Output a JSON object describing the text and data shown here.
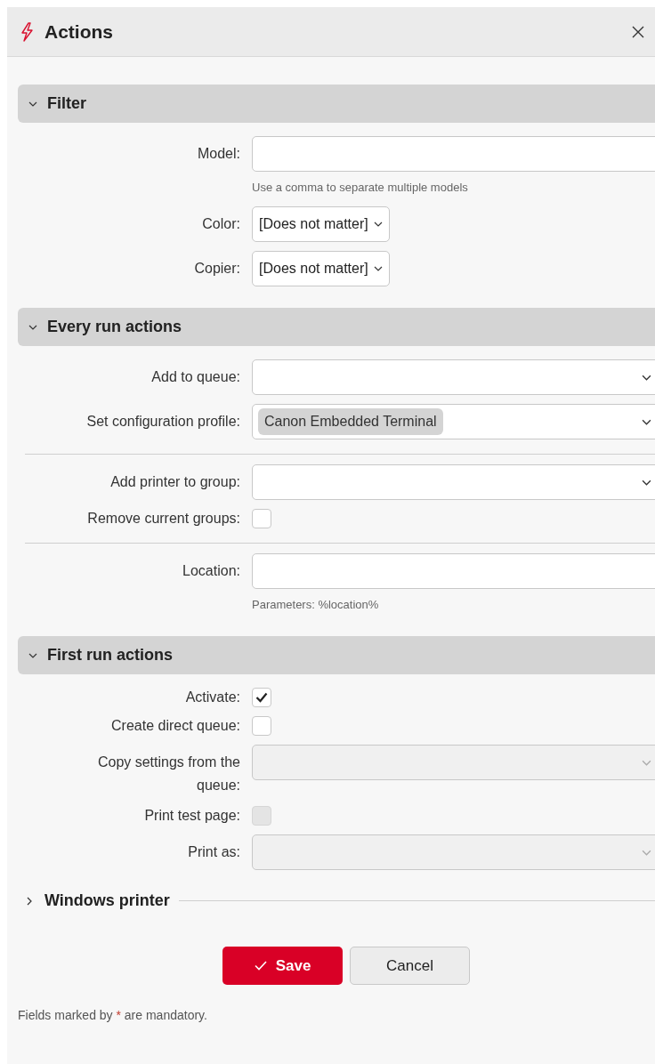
{
  "dialog": {
    "title": "Actions"
  },
  "sections": [
    {
      "title": "Filter",
      "expanded": true,
      "rows": [
        {
          "kind": "text",
          "label": "Model:",
          "hint": "Use a comma to separate multiple models"
        },
        {
          "kind": "select",
          "label": "Color:",
          "value": "[Does not matter]"
        },
        {
          "kind": "select",
          "label": "Copier:",
          "value": "[Does not matter]"
        }
      ]
    },
    {
      "title": "Every run actions",
      "expanded": true,
      "rows": [
        {
          "kind": "combo",
          "label": "Add to queue:",
          "disabled": false
        },
        {
          "kind": "combo",
          "label": "Set configuration profile:",
          "disabled": false,
          "tags": [
            "Canon Embedded Terminal"
          ]
        },
        {
          "kind": "divider"
        },
        {
          "kind": "combo",
          "label": "Add printer to group:",
          "disabled": false
        },
        {
          "kind": "checkbox",
          "label": "Remove current groups:",
          "checked": false,
          "disabled": false
        },
        {
          "kind": "divider"
        },
        {
          "kind": "text",
          "label": "Location:",
          "hint": "Parameters: %location%"
        }
      ]
    },
    {
      "title": "First run actions",
      "expanded": true,
      "rows": [
        {
          "kind": "checkbox",
          "label": "Activate:",
          "checked": true,
          "disabled": false
        },
        {
          "kind": "checkbox",
          "label": "Create direct queue:",
          "checked": false,
          "disabled": false
        },
        {
          "kind": "combo",
          "label": "Copy settings from the queue:",
          "disabled": true
        },
        {
          "kind": "checkbox",
          "label": "Print test page:",
          "checked": false,
          "disabled": true
        },
        {
          "kind": "combo",
          "label": "Print as:",
          "disabled": true
        }
      ]
    },
    {
      "title": "Windows printer",
      "expanded": false
    }
  ],
  "buttons": [
    {
      "kind": "primary",
      "label": "Save"
    },
    {
      "kind": "secondary",
      "label": "Cancel"
    }
  ],
  "footnote": {
    "before": "Fields marked by",
    "mark": "*",
    "after": "are mandatory."
  }
}
